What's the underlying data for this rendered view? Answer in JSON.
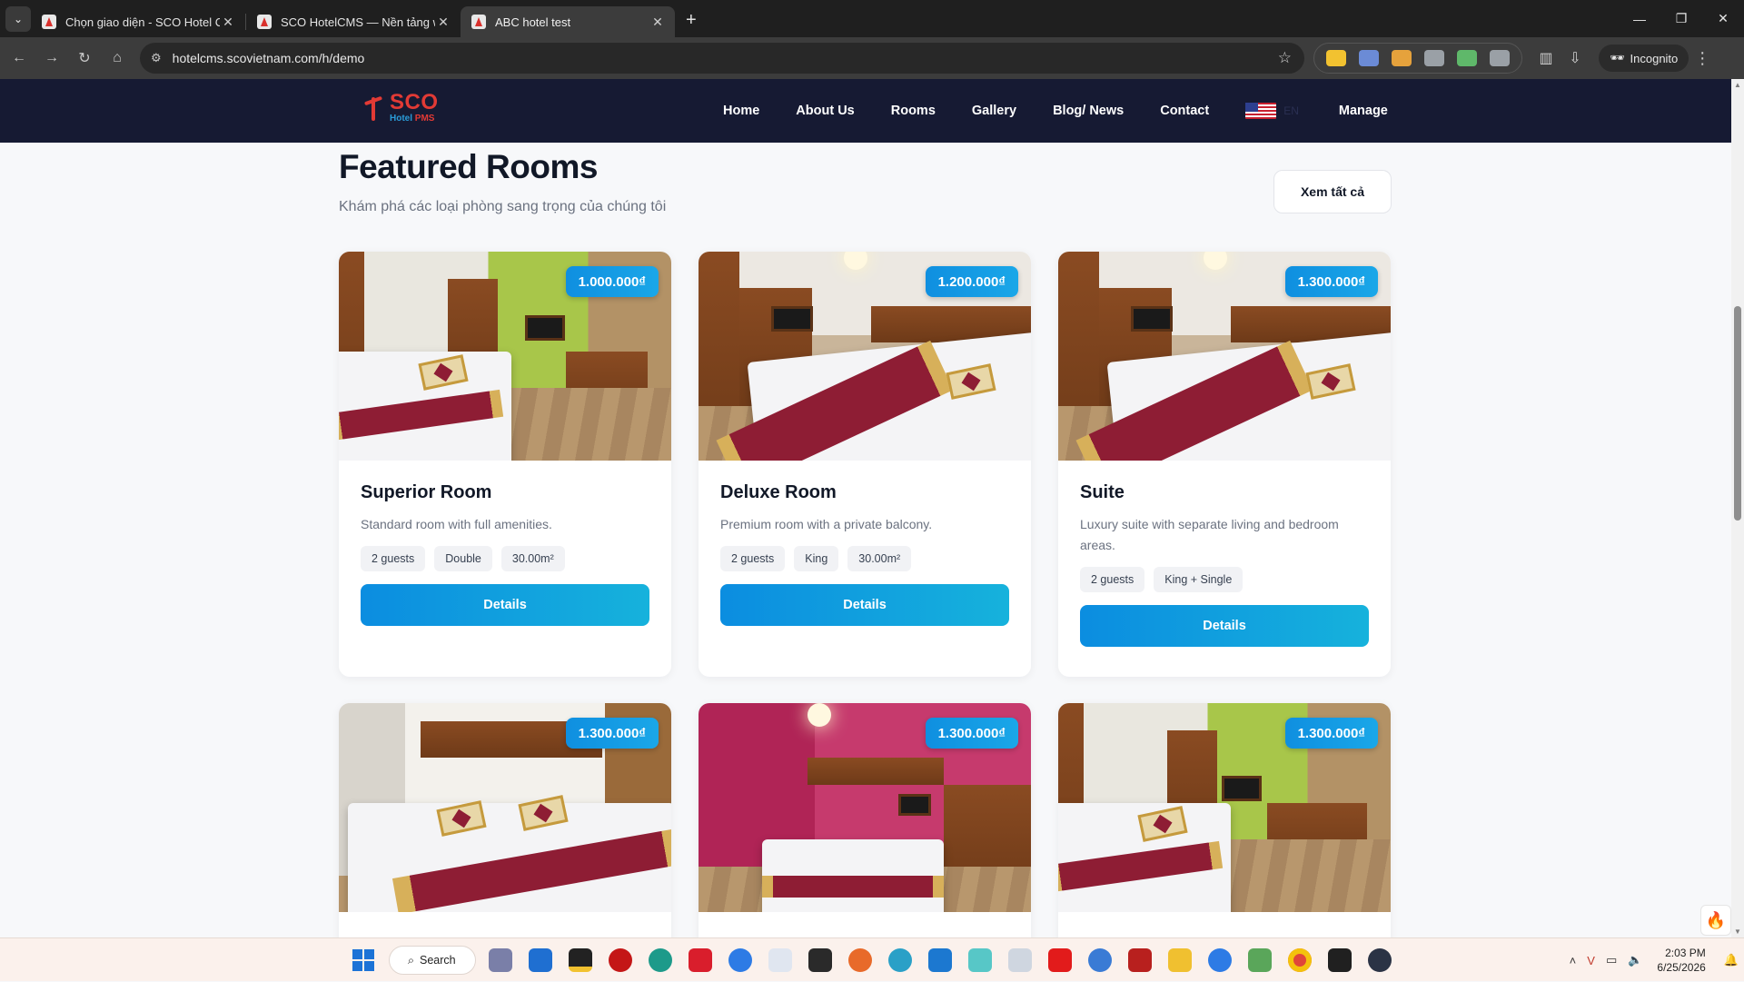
{
  "browser": {
    "tabs": [
      {
        "title": "Chọn giao diện - SCO Hotel CMS",
        "active": false
      },
      {
        "title": "SCO HotelCMS — Nền tảng web",
        "active": false
      },
      {
        "title": "ABC hotel test",
        "active": true
      }
    ],
    "url": "hotelcms.scovietnam.com/h/demo",
    "incognito_label": "Incognito"
  },
  "site": {
    "logo": {
      "word1": "SCO",
      "word2a": "Hotel",
      "word2b": "PMS"
    },
    "nav": [
      "Home",
      "About Us",
      "Rooms",
      "Gallery",
      "Blog/ News",
      "Contact"
    ],
    "lang_code": "EN",
    "manage_label": "Manage"
  },
  "section": {
    "title": "Featured Rooms",
    "subtitle": "Khám phá các loại phòng sang trọng của chúng tôi",
    "see_all_label": "Xem tất cả"
  },
  "rooms": [
    {
      "name": "Superior Room",
      "price": "1.000.000₫",
      "description": "Standard room with full amenities.",
      "tags": [
        "2 guests",
        "Double",
        "30.00m²"
      ],
      "button": "Details"
    },
    {
      "name": "Deluxe Room",
      "price": "1.200.000₫",
      "description": "Premium room with a private balcony.",
      "tags": [
        "2 guests",
        "King",
        "30.00m²"
      ],
      "button": "Details"
    },
    {
      "name": "Suite",
      "price": "1.300.000₫",
      "description": "Luxury suite with separate living and bedroom areas.",
      "tags": [
        "2 guests",
        "King + Single"
      ],
      "button": "Details"
    },
    {
      "price": "1.300.000₫"
    },
    {
      "price": "1.300.000₫"
    },
    {
      "price": "1.300.000₫"
    }
  ],
  "taskbar": {
    "search_label": "Search",
    "time": "2:03 PM",
    "date": "6/25/2026"
  },
  "colors": {
    "header_bg": "#161a33",
    "accent": "#0f8fe0",
    "brand_red": "#e23a35"
  }
}
